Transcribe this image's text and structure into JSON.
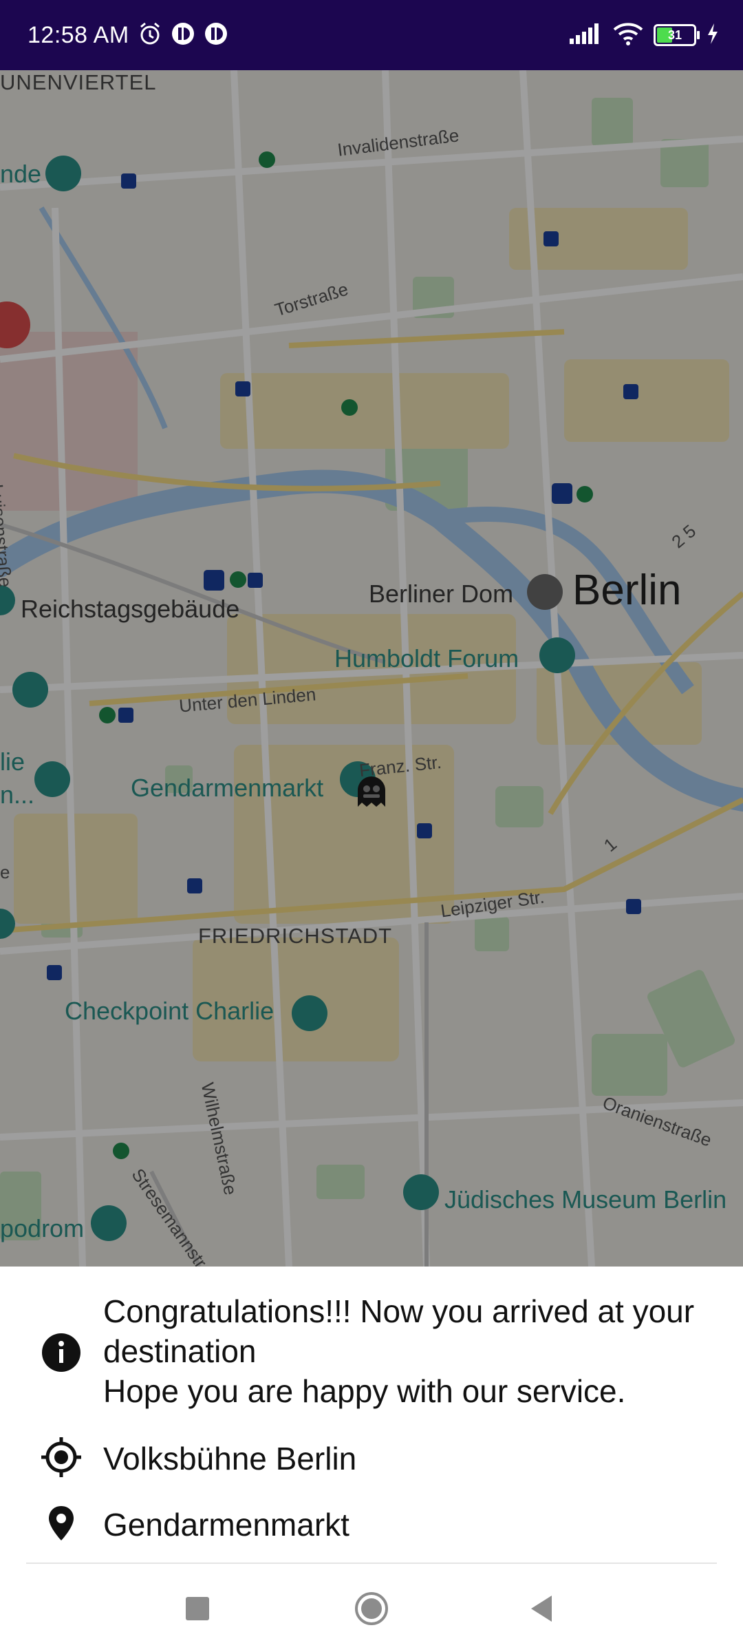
{
  "status_bar": {
    "time": "12:58 AM",
    "battery_level": "31",
    "icons": [
      "alarm-icon",
      "app-notification-icon",
      "app-notification-icon",
      "signal-icon",
      "wifi-icon",
      "battery-icon",
      "charging-icon"
    ]
  },
  "map": {
    "labels": {
      "unenviertel": "UNENVIERTEL",
      "invalidenstrasse": "Invalidenstraße",
      "torstrasse": "Torstraße",
      "luisenstrasse": "Luisenstraße",
      "reichstag": "Reichstagsgebäude",
      "berliner_dom": "Berliner Dom",
      "berlin": "Berlin",
      "humboldt_forum": "Humboldt Forum",
      "unter_den_linden": "Unter den Linden",
      "gendarmenmarkt": "Gendarmenmarkt",
      "franz_str": "Franz. Str.",
      "friedrichstadt": "FRIEDRICHSTADT",
      "leipziger_str": "Leipziger Str.",
      "checkpoint_charlie": "Checkpoint Charlie",
      "wilhelmstrasse": "Wilhelmstraße",
      "oranienstrasse": "Oranienstraße",
      "juedisches_museum": "Jüdisches Museum Berlin",
      "stresemannstr": "Stresemannstr",
      "podrom": "podrom",
      "nde": "nde",
      "road_25": "2 5",
      "road_1": "1",
      "lie": "lie",
      "n_ellipsis": "n...",
      "e_edge": "e"
    },
    "accent_teal": "#2a8e86",
    "overlay_color": "rgba(0,0,0,0.38)"
  },
  "trip": {
    "message": "Congratulations!!! Now you arrived at your destination\n Hope you are happy with our service.",
    "origin": "Volksbühne Berlin",
    "destination": "Gendarmenmarkt"
  },
  "nav_bar": {
    "buttons": [
      "recents-button",
      "home-button",
      "back-button"
    ]
  }
}
